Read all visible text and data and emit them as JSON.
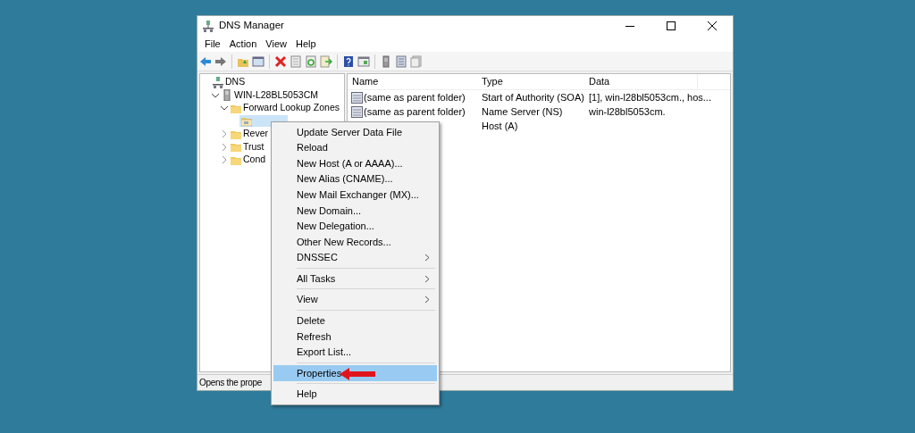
{
  "window": {
    "title": "DNS Manager"
  },
  "menu_bar": [
    "File",
    "Action",
    "View",
    "Help"
  ],
  "tree": [
    {
      "label": "DNS",
      "kind": "root",
      "expanded": true,
      "children": [
        {
          "label": "WIN-L28BL5053CM",
          "kind": "server",
          "expanded": true,
          "children": [
            {
              "label": "Forward Lookup Zones",
              "kind": "folder",
              "expanded": true,
              "children": [
                {
                  "kind": "zone",
                  "selected": true
                }
              ]
            },
            {
              "label": "Rever",
              "kind": "folder",
              "expanded": false
            },
            {
              "label": "Trust",
              "kind": "folder",
              "expanded": false
            },
            {
              "label": "Cond",
              "kind": "folder",
              "expanded": false
            }
          ]
        }
      ]
    }
  ],
  "table": {
    "columns": [
      "Name",
      "Type",
      "Data"
    ],
    "rows": [
      {
        "name": "(same as parent folder)",
        "type": "Start of Authority (SOA)",
        "data": "[1], win-l28bl5053cm., hos..."
      },
      {
        "name": "(same as parent folder)",
        "type": "Name Server (NS)",
        "data": "win-l28bl5053cm."
      },
      {
        "type": "Host (A)"
      }
    ]
  },
  "status_bar": "Opens the prope",
  "context_menu": [
    {
      "kind": "item",
      "label": "Update Server Data File",
      "submenu": false,
      "selected": false
    },
    {
      "kind": "item",
      "label": "Reload",
      "submenu": false,
      "selected": false
    },
    {
      "kind": "item",
      "label": "New Host (A or AAAA)...",
      "submenu": false,
      "selected": false
    },
    {
      "kind": "item",
      "label": "New Alias (CNAME)...",
      "submenu": false,
      "selected": false
    },
    {
      "kind": "item",
      "label": "New Mail Exchanger (MX)...",
      "submenu": false,
      "selected": false
    },
    {
      "kind": "item",
      "label": "New Domain...",
      "submenu": false,
      "selected": false
    },
    {
      "kind": "item",
      "label": "New Delegation...",
      "submenu": false,
      "selected": false
    },
    {
      "kind": "item",
      "label": "Other New Records...",
      "submenu": false,
      "selected": false
    },
    {
      "kind": "item",
      "label": "DNSSEC",
      "submenu": true,
      "selected": false
    },
    {
      "kind": "separator"
    },
    {
      "kind": "item",
      "label": "All Tasks",
      "submenu": true,
      "selected": false
    },
    {
      "kind": "separator"
    },
    {
      "kind": "item",
      "label": "View",
      "submenu": true,
      "selected": false
    },
    {
      "kind": "separator"
    },
    {
      "kind": "item",
      "label": "Delete",
      "submenu": false,
      "selected": false
    },
    {
      "kind": "item",
      "label": "Refresh",
      "submenu": false,
      "selected": false
    },
    {
      "kind": "item",
      "label": "Export List...",
      "submenu": false,
      "selected": false
    },
    {
      "kind": "separator"
    },
    {
      "kind": "item",
      "label": "Properties",
      "submenu": false,
      "selected": true,
      "pointed": true
    },
    {
      "kind": "separator"
    },
    {
      "kind": "item",
      "label": "Help",
      "submenu": false,
      "selected": false
    }
  ]
}
